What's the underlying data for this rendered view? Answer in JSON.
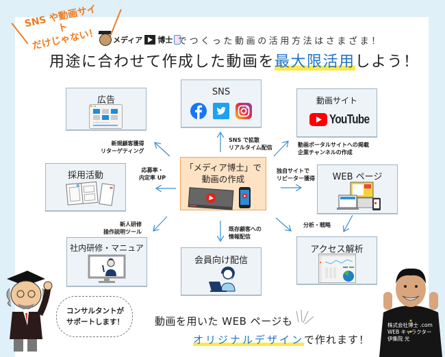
{
  "callout": {
    "line1": "SNS や動画サイト",
    "line2": "だけじゃない！"
  },
  "header": {
    "brand_name": "メディア博士",
    "subtitle": "でつくった動画の活用方法はさまざま！",
    "headline_pre": "用途に合わせて作成した動画を",
    "headline_highlight": "最大限活用",
    "headline_post": "しよう！"
  },
  "center": {
    "line1": "「メディア博士」で",
    "line2": "動画の作成"
  },
  "boxes": {
    "ad": {
      "title": "広告",
      "icon": "ad-layout-icon"
    },
    "sns": {
      "title": "SNS",
      "icons": [
        "facebook-icon",
        "twitter-icon",
        "instagram-icon"
      ]
    },
    "video_site": {
      "title": "動画サイト",
      "logo_text": "YouTube"
    },
    "recruit": {
      "title": "採用活動",
      "icon": "documents-icon"
    },
    "web": {
      "title": "WEB ページ",
      "icon": "devices-icon"
    },
    "training": {
      "title": "社内研修・マニュアル",
      "icon": "monitor-presenter-icon"
    },
    "member": {
      "title": "会員向け配信",
      "icon": "laptop-user-icon"
    },
    "analytics": {
      "title": "アクセス解析",
      "icon": "analytics-dashboard-icon"
    }
  },
  "arrow_labels": {
    "ad": [
      "新規顧客獲得",
      "リターゲティング"
    ],
    "sns": [
      "SNS で拡散",
      "リアルタイム配信"
    ],
    "video_site": [
      "動画ポータルサイトへの掲載",
      "企業チャンネルの作成"
    ],
    "recruit": [
      "応募率・",
      "内定率 UP"
    ],
    "web": [
      "独自サイトで",
      "リピーター獲得"
    ],
    "training": [
      "新人研修",
      "操作説明ツール"
    ],
    "member": [
      "既存顧客への",
      "情報配信"
    ],
    "analytics": [
      "分析・戦略"
    ]
  },
  "bubble": {
    "line1": "コンサルタントが",
    "line2": "サポートします！"
  },
  "bottom_message": {
    "line1": "動画を用いた WEB ページも",
    "line2_highlight": "オリジナルデザイン",
    "line2_post": "で作れます！"
  },
  "character_caption": {
    "line1": "株式会社博士 .com",
    "line2": "WEB キャラクター",
    "line3": "伊集院 光"
  },
  "colors": {
    "background": "#dff0f9",
    "accent_orange": "#f07c1e",
    "accent_blue": "#1f73c4",
    "highlight_yellow": "#fbe94a",
    "arrow_blue": "#3a8fd0",
    "box_fill": "#eef3f8",
    "center_fill": "#fde2c4"
  }
}
